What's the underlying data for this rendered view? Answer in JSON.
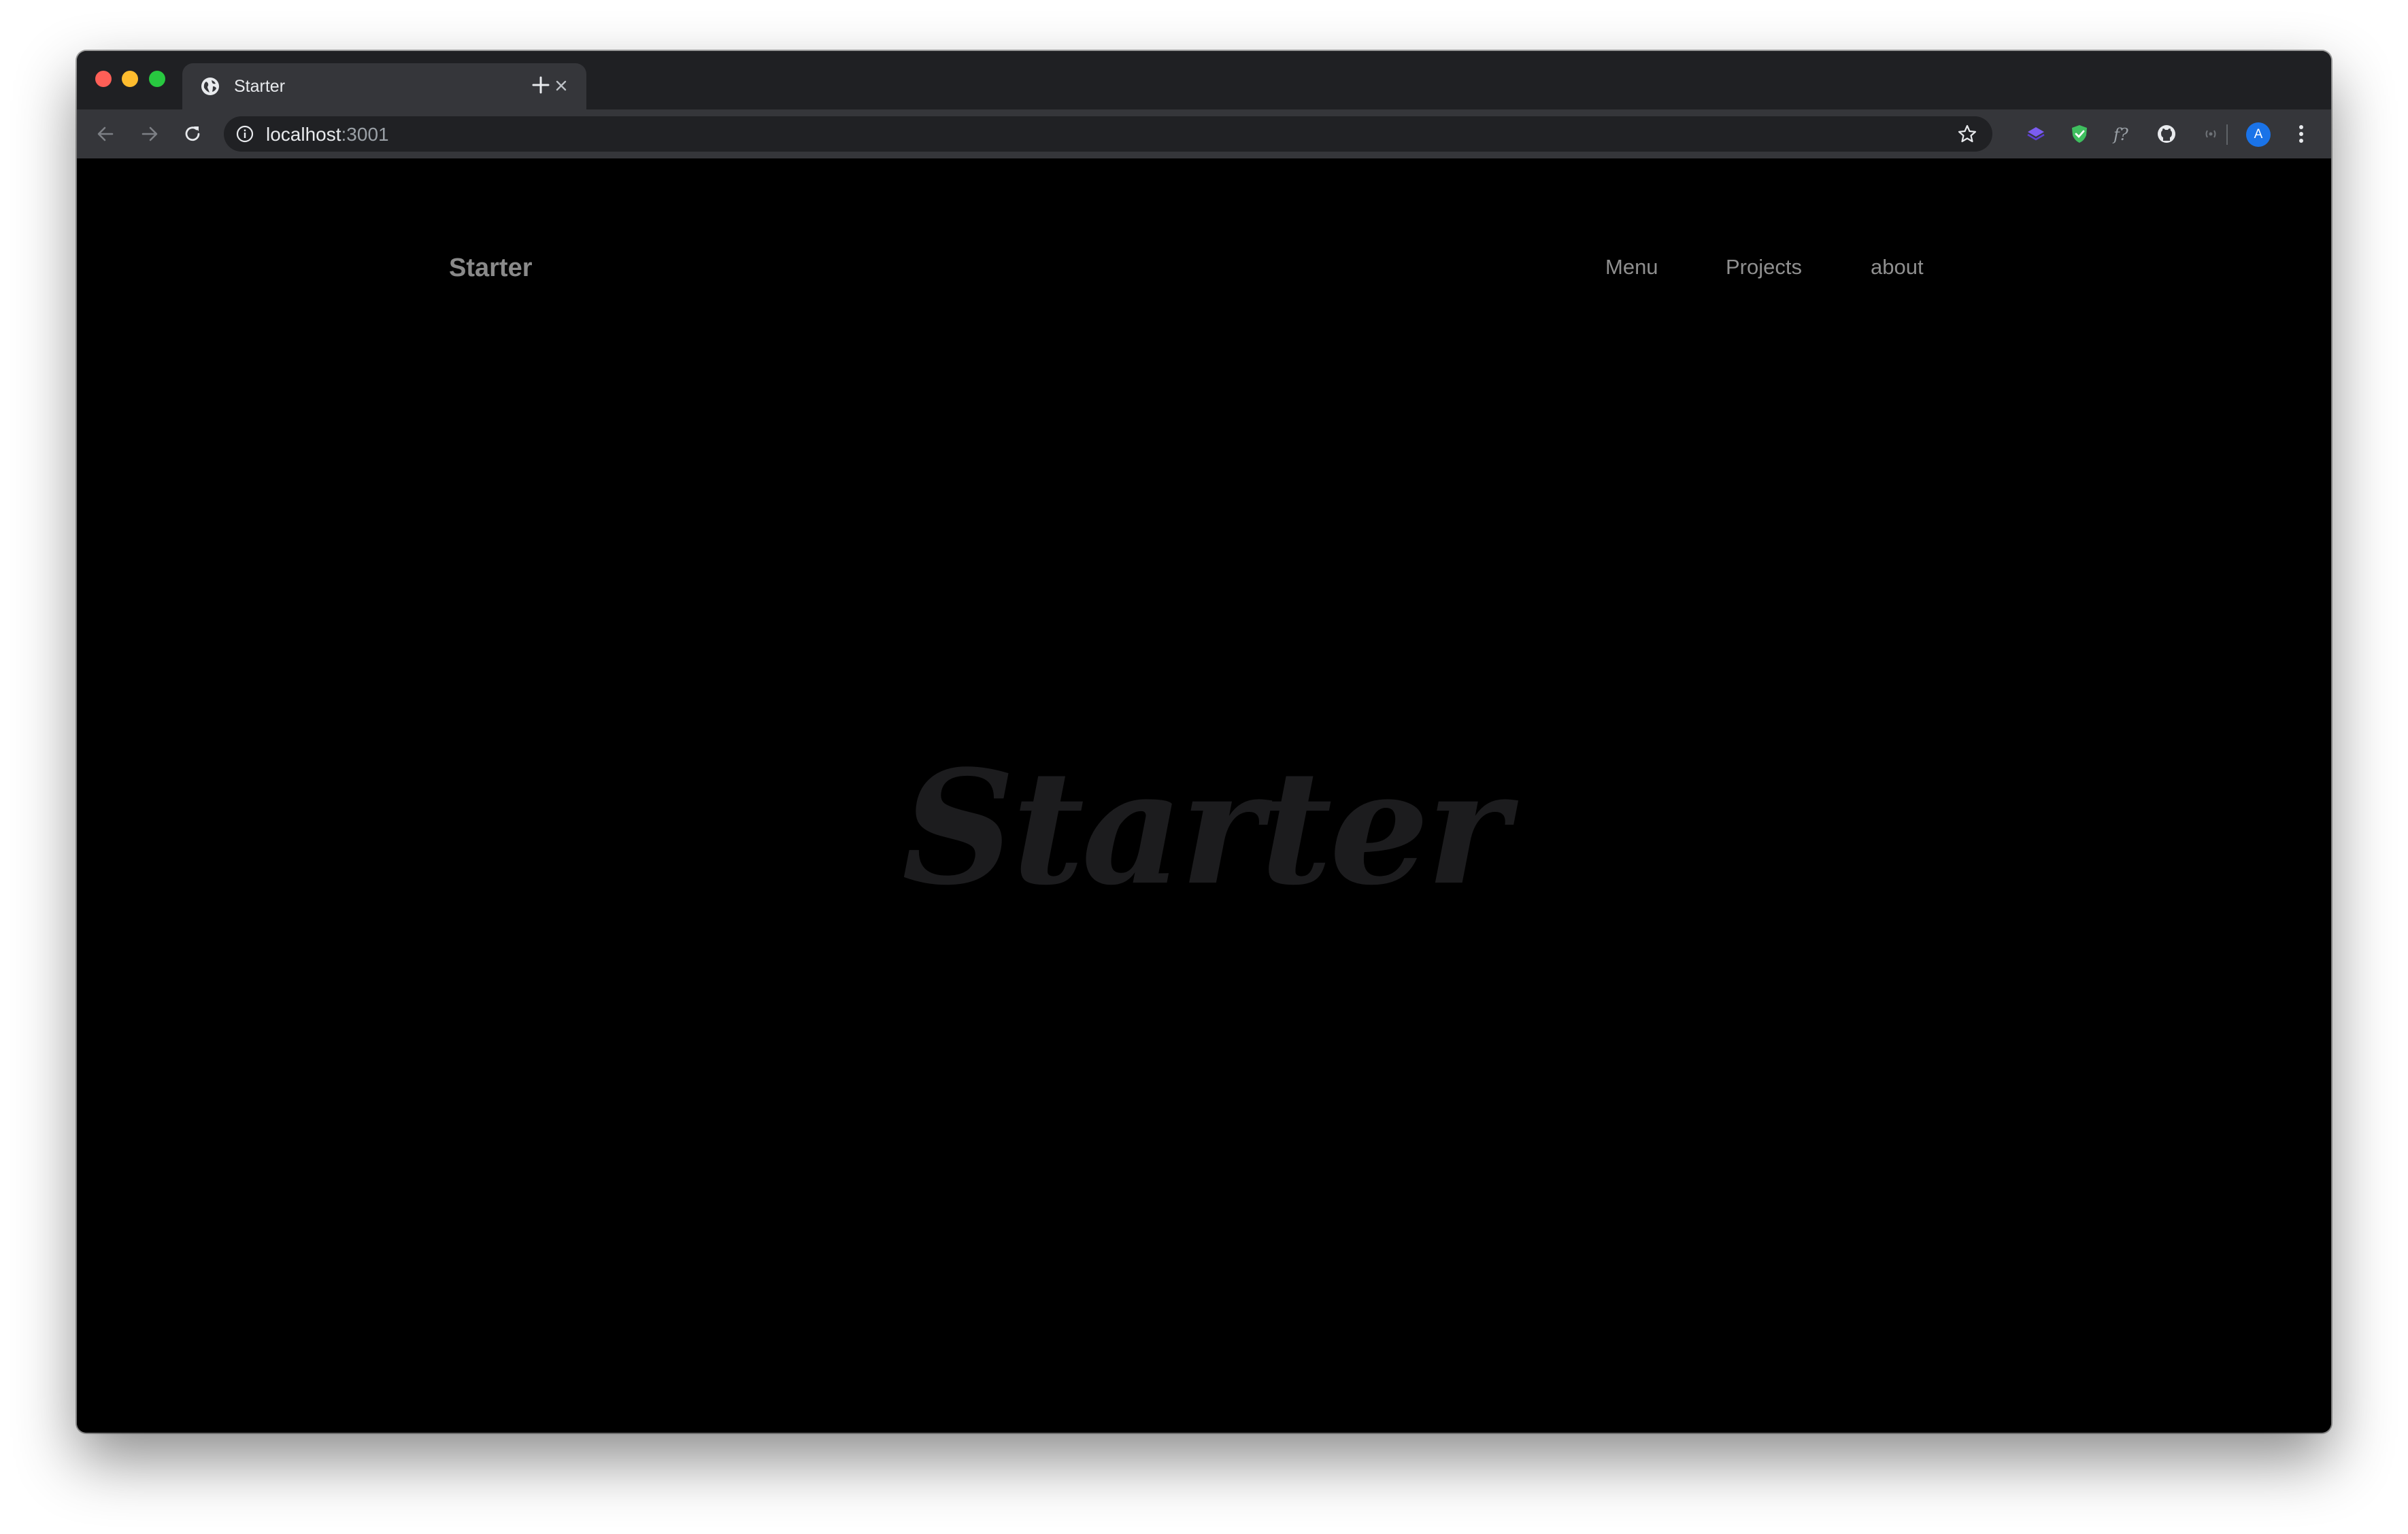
{
  "browser": {
    "tab": {
      "title": "Starter"
    },
    "address": {
      "host": "localhost",
      "port": ":3001"
    },
    "profile_initial": "A"
  },
  "site": {
    "brand": "Starter",
    "nav": [
      "Menu",
      "Projects",
      "about"
    ],
    "hero_title": "Starter"
  },
  "colors": {
    "background": "#000000",
    "nav_text": "#8f8f8f",
    "hero_text": "#1c1c1e",
    "avatar": "#1a73e8"
  }
}
